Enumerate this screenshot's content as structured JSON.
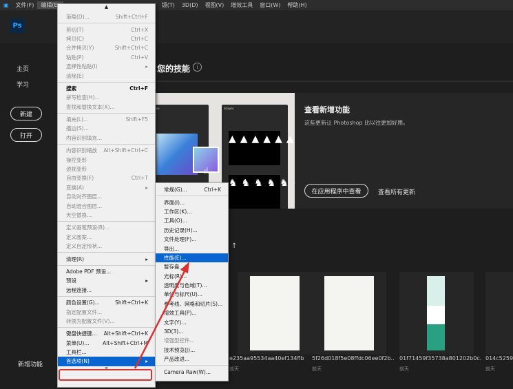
{
  "menubar": {
    "items": [
      "文件(F)",
      "编辑(E)",
      "镜(T)",
      "3D(D)",
      "视图(V)",
      "增效工具",
      "窗口(W)",
      "帮助(H)"
    ]
  },
  "app": {
    "logo": "Ps"
  },
  "sidebar": {
    "home": "主页",
    "learn": "学习",
    "new": "新建",
    "open": "打开",
    "whats_new": "新增功能"
  },
  "main": {
    "heading": "您的技能",
    "banner": {
      "title": "查看新增功能",
      "desc": "这些更新让 Photoshop 比以往更加好用。",
      "view_in_app": "在应用程序中查看",
      "view_all": "查看所有更新",
      "panel1": "es",
      "panel2": "Shapes"
    },
    "recent": [
      {
        "name": "e235aa95534aa40ef134flb...",
        "date": "前天"
      },
      {
        "name": "5f26d018f5e08ffdc06ee0f2b...",
        "date": "前天"
      },
      {
        "name": "01f71459f35738a801202b0c...",
        "date": "前天"
      },
      {
        "name": "014c5259",
        "date": "前天"
      }
    ]
  },
  "edit_menu": [
    {
      "label": "渐隐(D)...",
      "shortcut": "Shift+Ctrl+F",
      "dis": true
    },
    {
      "sep": true
    },
    {
      "label": "剪切(T)",
      "shortcut": "Ctrl+X",
      "dis": true
    },
    {
      "label": "拷贝(C)",
      "shortcut": "Ctrl+C",
      "dis": true
    },
    {
      "label": "合并拷贝(Y)",
      "shortcut": "Shift+Ctrl+C",
      "dis": true
    },
    {
      "label": "粘贴(P)",
      "shortcut": "Ctrl+V",
      "dis": true
    },
    {
      "label": "选择性粘贴(I)",
      "shortcut": "▸",
      "dis": true
    },
    {
      "label": "清除(E)",
      "shortcut": "",
      "dis": true
    },
    {
      "sep": true
    },
    {
      "label": "搜索",
      "shortcut": "Ctrl+F",
      "bold": true
    },
    {
      "label": "拼写检查(H)...",
      "shortcut": "",
      "dis": true
    },
    {
      "label": "查找和替换文本(X)...",
      "shortcut": "",
      "dis": true
    },
    {
      "sep": true
    },
    {
      "label": "填充(L)...",
      "shortcut": "Shift+F5",
      "dis": true
    },
    {
      "label": "描边(S)...",
      "shortcut": "",
      "dis": true
    },
    {
      "label": "内容识别填充...",
      "shortcut": "",
      "dis": true
    },
    {
      "sep": true
    },
    {
      "label": "内容识别缩放",
      "shortcut": "Alt+Shift+Ctrl+C",
      "dis": true
    },
    {
      "label": "操控变形",
      "shortcut": "",
      "dis": true
    },
    {
      "label": "透视变形",
      "shortcut": "",
      "dis": true
    },
    {
      "label": "自由变换(F)",
      "shortcut": "Ctrl+T",
      "dis": true
    },
    {
      "label": "变换(A)",
      "shortcut": "▸",
      "dis": true
    },
    {
      "label": "自动对齐图层...",
      "shortcut": "",
      "dis": true
    },
    {
      "label": "自动混合图层...",
      "shortcut": "",
      "dis": true
    },
    {
      "label": "天空替换...",
      "shortcut": "",
      "dis": true
    },
    {
      "sep": true
    },
    {
      "label": "定义画笔预设(B)...",
      "shortcut": "",
      "dis": true
    },
    {
      "label": "定义图案...",
      "shortcut": "",
      "dis": true
    },
    {
      "label": "定义自定形状...",
      "shortcut": "",
      "dis": true
    },
    {
      "sep": true
    },
    {
      "label": "清理(R)",
      "shortcut": "▸"
    },
    {
      "sep": true
    },
    {
      "label": "Adobe PDF 预设...",
      "shortcut": ""
    },
    {
      "label": "预设",
      "shortcut": "▸"
    },
    {
      "label": "远程连接...",
      "shortcut": ""
    },
    {
      "sep": true
    },
    {
      "label": "颜色设置(G)...",
      "shortcut": "Shift+Ctrl+K"
    },
    {
      "label": "指定配置文件...",
      "shortcut": "",
      "dis": true
    },
    {
      "label": "转换为配置文件(V)...",
      "shortcut": "",
      "dis": true
    },
    {
      "sep": true
    },
    {
      "label": "键盘快捷键...",
      "shortcut": "Alt+Shift+Ctrl+K"
    },
    {
      "label": "菜单(U)...",
      "shortcut": "Alt+Shift+Ctrl+M"
    },
    {
      "label": "工具栏...",
      "shortcut": ""
    },
    {
      "label": "首选项(N)",
      "shortcut": "▸",
      "hl": true
    }
  ],
  "prefs_menu": [
    {
      "label": "常规(G)...",
      "shortcut": "Ctrl+K"
    },
    {
      "sep": true
    },
    {
      "label": "界面(I)..."
    },
    {
      "label": "工作区(K)..."
    },
    {
      "label": "工具(O)..."
    },
    {
      "label": "历史记录(H)..."
    },
    {
      "label": "文件处理(F)..."
    },
    {
      "label": "导出..."
    },
    {
      "label": "性能(E)...",
      "hl": true
    },
    {
      "label": "暂存盘..."
    },
    {
      "label": "光标(R)..."
    },
    {
      "label": "透明度与色域(T)..."
    },
    {
      "label": "单位与标尺(U)..."
    },
    {
      "label": "参考线、网格和切片(S)..."
    },
    {
      "label": "增效工具(P)..."
    },
    {
      "label": "文字(Y)..."
    },
    {
      "label": "3D(3)..."
    },
    {
      "label": "增强型控件...",
      "dis": true
    },
    {
      "label": "技术预览(J)..."
    },
    {
      "label": "产品改进..."
    },
    {
      "sep": true
    },
    {
      "label": "Camera Raw(W)..."
    }
  ],
  "colors": {
    "highlight": "#0a64d0",
    "annotation": "#d93030"
  }
}
